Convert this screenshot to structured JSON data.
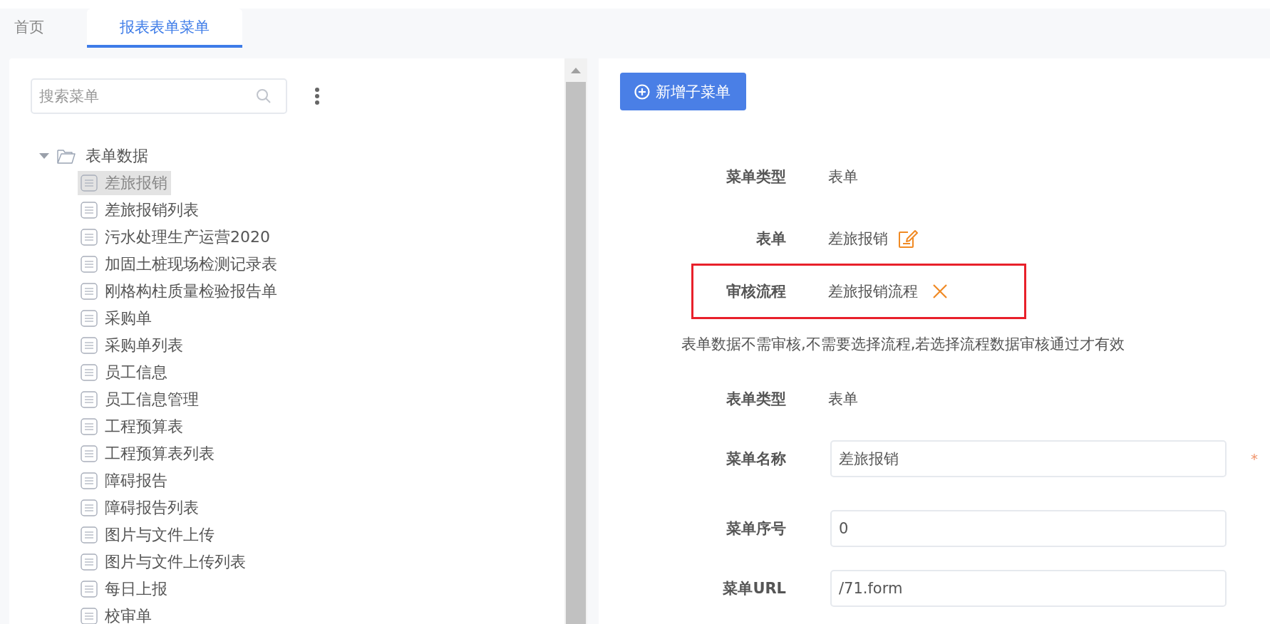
{
  "tabs": [
    {
      "label": "首页",
      "selected": false
    },
    {
      "label": "报表表单菜单",
      "selected": true
    }
  ],
  "sidebar": {
    "search": {
      "placeholder": "搜索菜单"
    },
    "tree": [
      {
        "label": "表单数据",
        "kind": "folder",
        "expanded": true,
        "selected": false,
        "children": [
          {
            "label": "差旅报销",
            "kind": "form",
            "selected": true
          },
          {
            "label": "差旅报销列表",
            "kind": "form",
            "selected": false
          },
          {
            "label": "污水处理生产运营2020",
            "kind": "form",
            "selected": false
          },
          {
            "label": "加固土桩现场检测记录表",
            "kind": "form",
            "selected": false
          },
          {
            "label": "刚格构柱质量检验报告单",
            "kind": "form",
            "selected": false
          },
          {
            "label": "采购单",
            "kind": "form",
            "selected": false
          },
          {
            "label": "采购单列表",
            "kind": "form",
            "selected": false
          },
          {
            "label": "员工信息",
            "kind": "form",
            "selected": false
          },
          {
            "label": "员工信息管理",
            "kind": "form",
            "selected": false
          },
          {
            "label": "工程预算表",
            "kind": "form",
            "selected": false
          },
          {
            "label": "工程预算表列表",
            "kind": "form",
            "selected": false
          },
          {
            "label": "障碍报告",
            "kind": "form",
            "selected": false
          },
          {
            "label": "障碍报告列表",
            "kind": "form",
            "selected": false
          },
          {
            "label": "图片与文件上传",
            "kind": "form",
            "selected": false
          },
          {
            "label": "图片与文件上传列表",
            "kind": "form",
            "selected": false
          },
          {
            "label": "每日上报",
            "kind": "form",
            "selected": false
          },
          {
            "label": "校审单",
            "kind": "form",
            "selected": false
          }
        ]
      }
    ]
  },
  "detail": {
    "add_button": "新增子菜单",
    "rows": [
      {
        "kind": "text",
        "label": "菜单类型",
        "value": "表单"
      },
      {
        "kind": "edit",
        "label": "表单",
        "value": "差旅报销"
      },
      {
        "kind": "clear",
        "label": "审核流程",
        "value": "差旅报销流程",
        "highlighted": true
      },
      {
        "kind": "note",
        "text": "表单数据不需审核,不需要选择流程,若选择流程数据审核通过才有效"
      },
      {
        "kind": "text",
        "label": "表单类型",
        "value": "表单"
      },
      {
        "kind": "input",
        "label": "菜单名称",
        "value": "差旅报销",
        "required_mark": "*"
      },
      {
        "kind": "input",
        "label": "菜单序号",
        "value": "0"
      },
      {
        "kind": "input",
        "label": "菜单URL",
        "value": "/71.form"
      }
    ]
  }
}
